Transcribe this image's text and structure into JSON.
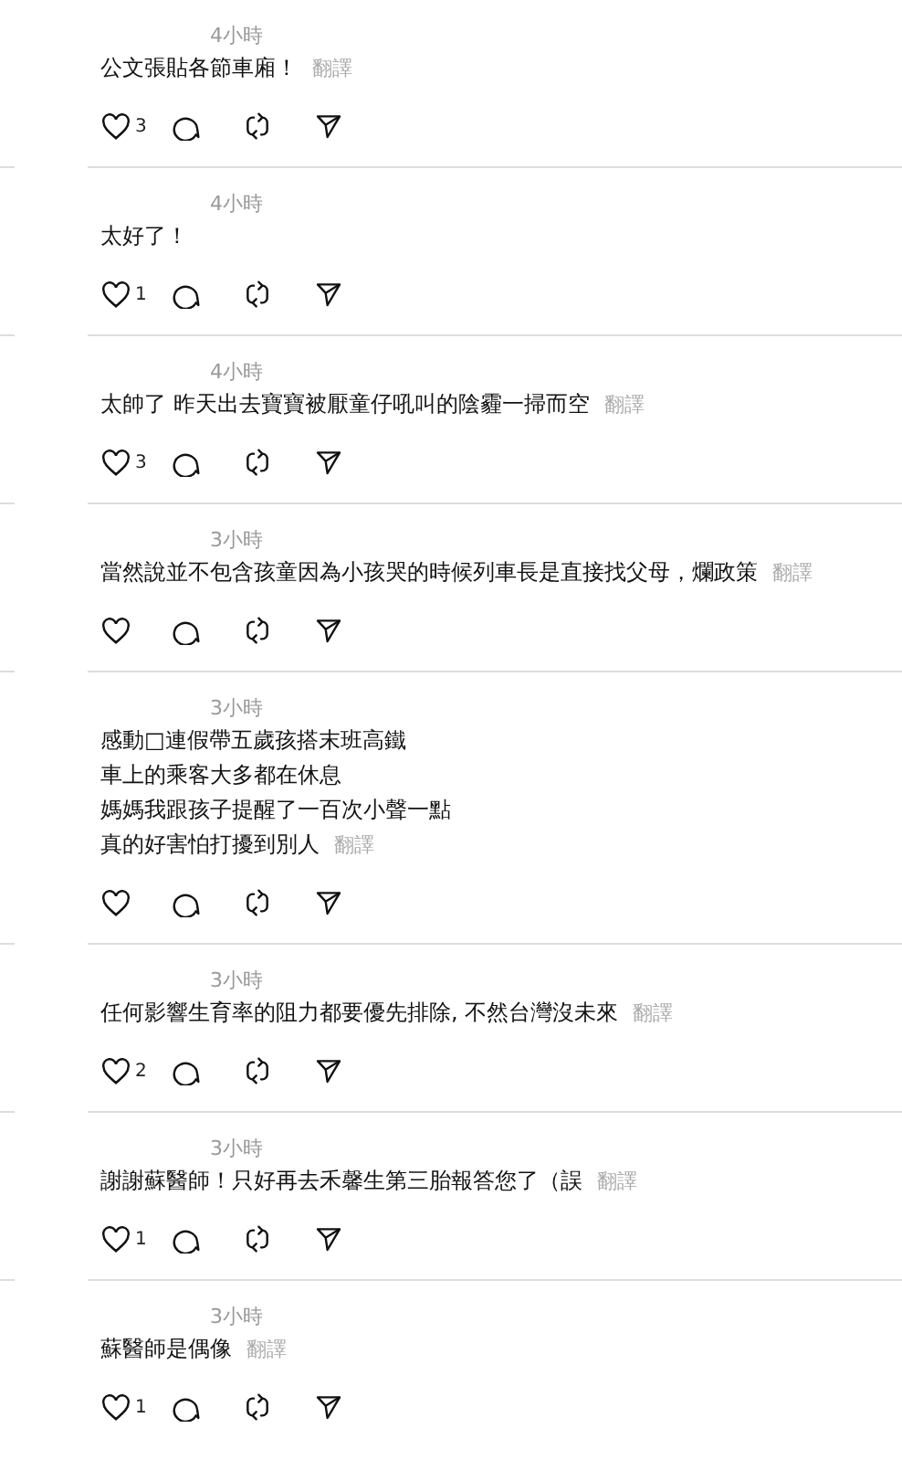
{
  "comments": [
    {
      "time": "4小時",
      "lines": [
        "公文張貼各節車廂！"
      ],
      "translate": "翻譯",
      "likes": "3"
    },
    {
      "time": "4小時",
      "lines": [
        "太好了！"
      ],
      "likes": "1"
    },
    {
      "time": "4小時",
      "lines": [
        "太帥了 昨天出去寶寶被厭童仔吼叫的陰霾一掃而空"
      ],
      "translate": "翻譯",
      "likes": "3"
    },
    {
      "time": "3小時",
      "lines": [
        "當然說並不包含孩童因為小孩哭的時候列車長是直接找父母，爛政策"
      ],
      "translate": "翻譯"
    },
    {
      "time": "3小時",
      "lines": [
        "感動□連假帶五歲孩搭末班高鐵",
        "車上的乘客大多都在休息",
        "媽媽我跟孩子提醒了一百次小聲一點",
        "真的好害怕打擾到別人"
      ],
      "translate": "翻譯"
    },
    {
      "time": "3小時",
      "lines": [
        "任何影響生育率的阻力都要優先排除, 不然台灣沒未來"
      ],
      "translate": "翻譯",
      "likes": "2"
    },
    {
      "time": "3小時",
      "lines": [
        "謝謝蘇醫師！只好再去禾馨生第三胎報答您了（誤"
      ],
      "translate": "翻譯",
      "likes": "1"
    },
    {
      "time": "3小時",
      "lines": [
        "蘇醫師是偶像"
      ],
      "translate": "翻譯",
      "likes": "1"
    }
  ]
}
